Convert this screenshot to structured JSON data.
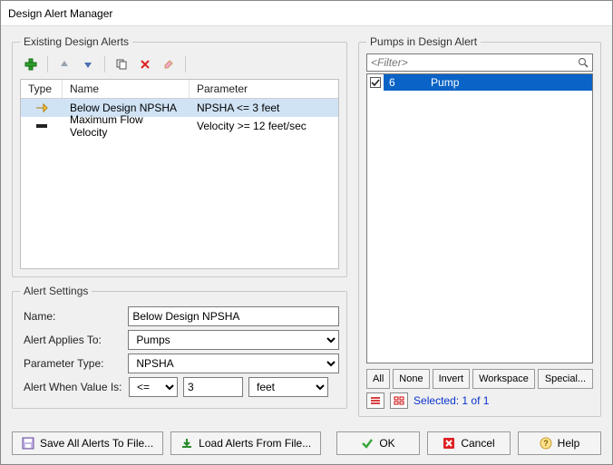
{
  "window": {
    "title": "Design Alert Manager"
  },
  "existing_alerts": {
    "legend": "Existing Design Alerts",
    "columns": {
      "type": "Type",
      "name": "Name",
      "parameter": "Parameter"
    },
    "rows": [
      {
        "name": "Below Design NPSHA",
        "parameter": "NPSHA <= 3 feet",
        "icon": "alert-yellow",
        "selected": true
      },
      {
        "name": "Maximum Flow Velocity",
        "parameter": "Velocity >= 12 feet/sec",
        "icon": "alert-black",
        "selected": false
      }
    ]
  },
  "alert_settings": {
    "legend": "Alert Settings",
    "labels": {
      "name": "Name:",
      "applies_to": "Alert Applies To:",
      "param_type": "Parameter Type:",
      "when": "Alert When Value Is:"
    },
    "values": {
      "name": "Below Design NPSHA",
      "applies_to": "Pumps",
      "param_type": "NPSHA",
      "operator": "<=",
      "value": "3",
      "unit": "feet"
    }
  },
  "pumps_panel": {
    "legend": "Pumps in Design Alert",
    "filter_placeholder": "<Filter>",
    "items": [
      {
        "id": "6",
        "name": "Pump",
        "checked": true
      }
    ],
    "selection_buttons": {
      "all": "All",
      "none": "None",
      "invert": "Invert",
      "workspace": "Workspace",
      "special": "Special..."
    },
    "selected_text": "Selected: 1 of 1"
  },
  "bottom_buttons": {
    "save_all": "Save All Alerts To File...",
    "load": "Load Alerts From File...",
    "ok": "OK",
    "cancel": "Cancel",
    "help": "Help"
  }
}
